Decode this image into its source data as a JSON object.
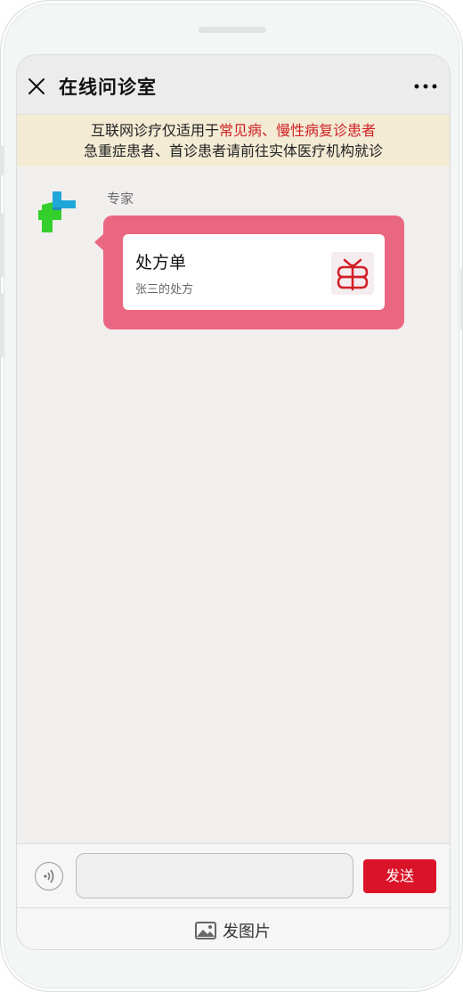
{
  "header": {
    "title": "在线问诊室"
  },
  "notice": {
    "line1_prefix": "互联网诊疗仅适用于",
    "line1_highlight": "常见病、慢性病复诊患者",
    "line2": "急重症患者、首诊患者请前往实体医疗机构就诊"
  },
  "chat": {
    "messages": [
      {
        "sender": "专家",
        "card": {
          "title": "处方单",
          "subtitle": "张三的处方",
          "icon": "prescription-icon"
        }
      }
    ]
  },
  "composer": {
    "text_value": "",
    "send_label": "发送",
    "voice_icon": "voice-icon"
  },
  "footer": {
    "photo_label": "发图片",
    "photo_icon": "image-icon"
  },
  "colors": {
    "accent_red": "#db1329",
    "bubble_pink": "#ea6782",
    "highlight_red": "#d11f26",
    "notice_bg": "#f3ebd4"
  }
}
